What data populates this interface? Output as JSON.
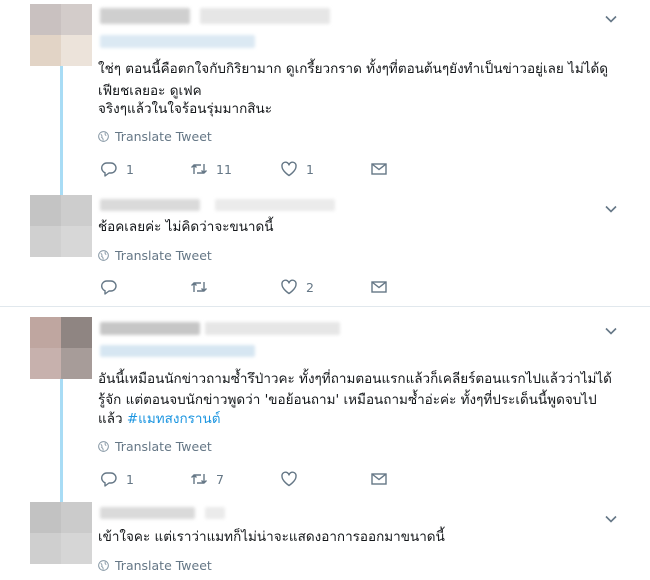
{
  "colors": {
    "accent": "#1b95e0",
    "thread_line": "#a8dcf5",
    "muted": "#657786",
    "divider": "#e1e8ed"
  },
  "tweets": [
    {
      "lines": [
        "ใช่ๆ ตอนนี้คือตกใจกับกิริยามาก ดูเกรี้ยวกราด ทั้งๆที่ตอนต้นๆยังทำเป็นข่าวอยู่เลย ไม่ได้ดู",
        "เฟียชเลยอะ ดูเฟค",
        "จริงๆแล้วในใจร้อนรุ่มมากสินะ"
      ],
      "translate": "Translate Tweet",
      "reply_count": "1",
      "retweet_count": "11",
      "like_count": "1"
    },
    {
      "lines": [
        "ช้อคเลยค่ะ ไม่คิดว่าจะขนาดนี้"
      ],
      "translate": "Translate Tweet",
      "reply_count": "",
      "retweet_count": "",
      "like_count": "2"
    },
    {
      "lines": [
        "อันนี้เหมือนนักข่าวถามซ้ำรึป่าวคะ ทั้งๆที่ถามตอนแรกแล้วก็เคลียร์ตอนแรกไปแล้วว่าไม่ได้",
        "รู้จัก แต่ตอนจบนักข่าวพูดว่า 'ขอย้อนถาม' เหมือนถามซ้ำอ่ะค่ะ ทั้งๆที่ประเด็นนี้พูดจบไป"
      ],
      "last_line_prefix": "แล้ว ",
      "hashtag": "#แมทสงกรานต์",
      "translate": "Translate Tweet",
      "reply_count": "1",
      "retweet_count": "7",
      "like_count": ""
    },
    {
      "lines": [
        "เข้าใจคะ แต่เราว่าแมทก็ไม่น่าจะแสดงอาการออกมาขนาดนี้"
      ],
      "translate": "Translate Tweet"
    }
  ]
}
